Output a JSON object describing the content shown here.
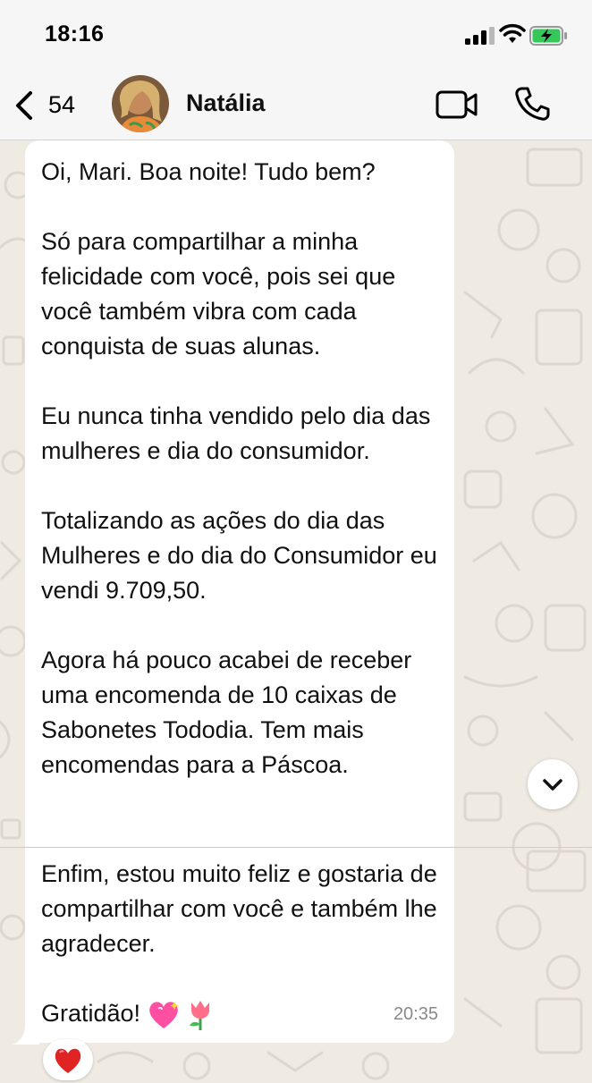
{
  "status_bar": {
    "time": "18:16"
  },
  "header": {
    "back_count": "54",
    "contact_name": "Natália"
  },
  "icons": {
    "back": "chevron-left-icon",
    "video": "video-call-icon",
    "phone": "phone-call-icon",
    "scroll": "chevron-down-icon",
    "reaction": "red-heart-emoji",
    "gratitude_1": "sparkling-heart-emoji",
    "gratitude_2": "tulip-emoji"
  },
  "colors": {
    "bubble": "#ffffff",
    "background": "#efeae2",
    "timestamp": "#8a8a8a",
    "battery": "#34c759"
  },
  "message": {
    "part1": [
      "Oi, Mari. Boa noite! Tudo bem?",
      "Só para compartilhar a minha felicidade com você, pois sei que você também vibra com cada conquista de suas alunas.",
      "Eu nunca tinha vendido pelo dia das mulheres e dia do consumidor.",
      "Totalizando as ações do dia das Mulheres e do dia do Consumidor eu vendi 9.709,50.",
      "Agora há pouco acabei de receber uma encomenda de 10 caixas de Sabonetes Tododia. Tem mais encomendas para a Páscoa."
    ],
    "part2": [
      "Enfim, estou muito feliz e gostaria de compartilhar com você e também lhe agradecer."
    ],
    "closing": "Gratidão!",
    "time": "20:35",
    "reaction": "❤️"
  }
}
